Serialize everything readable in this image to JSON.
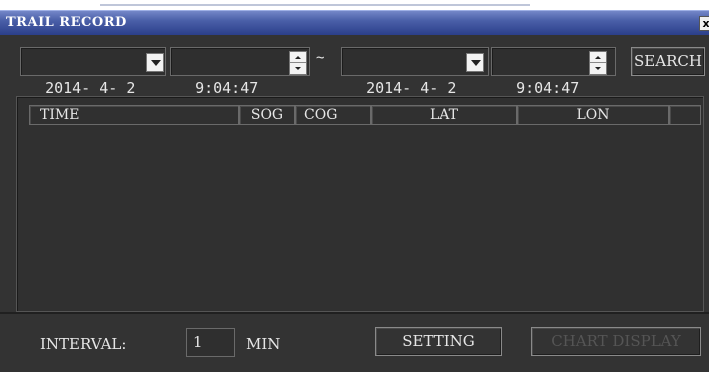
{
  "window": {
    "title": "TRAIL RECORD",
    "close_glyph": "x"
  },
  "search": {
    "start_date": "2014- 4- 2",
    "start_time": "9:04:47",
    "range_separator": "~",
    "end_date": "2014- 4- 2",
    "end_time": "9:04:47",
    "search_label": "SEARCH"
  },
  "table": {
    "columns": [
      "TIME",
      "SOG",
      "COG",
      "LAT",
      "LON",
      ""
    ],
    "rows": []
  },
  "footer": {
    "interval_label": "INTERVAL:",
    "interval_value": "1",
    "interval_unit": "MIN",
    "setting_label": "SETTING",
    "chart_display_label": "CHART DISPLAY"
  },
  "colors": {
    "window_bg": "#333333",
    "titlebar": "#3a4f9a",
    "text": "#e6e6e6",
    "disabled_text": "#555555"
  },
  "icons": [
    "close-icon",
    "dropdown-arrow-icon",
    "spin-up-icon",
    "spin-down-icon"
  ]
}
